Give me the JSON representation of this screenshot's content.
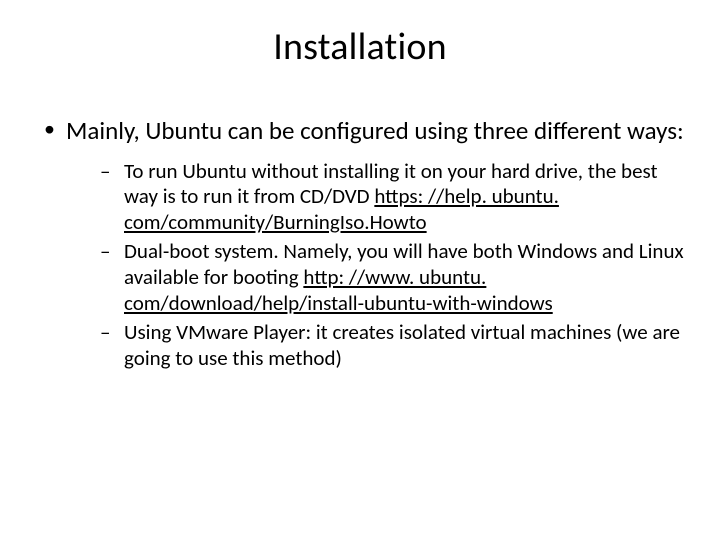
{
  "title": "Installation",
  "intro": "Mainly, Ubuntu can be configured using three different ways:",
  "items": [
    {
      "text": "To run Ubuntu without installing it on your hard drive, the best way is to run it from CD/DVD ",
      "link": "https: //help. ubuntu. com/community/BurningIso.Howto"
    },
    {
      "text": "Dual-boot system. Namely, you will have both Windows and Linux available for booting ",
      "link": "http: //www. ubuntu. com/download/help/install-ubuntu-with-windows"
    },
    {
      "text": "Using VMware Player: it creates isolated virtual machines (we are going to use this method)",
      "link": ""
    }
  ]
}
